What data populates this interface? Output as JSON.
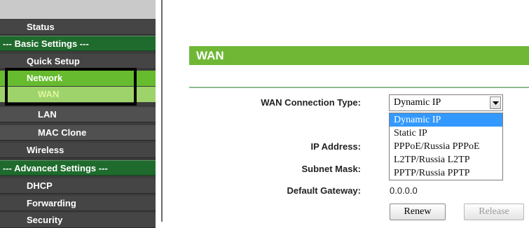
{
  "sidebar": {
    "items": [
      {
        "label": "Status"
      },
      {
        "label": "--- Basic Settings ---"
      },
      {
        "label": "Quick Setup"
      },
      {
        "label": "Network"
      },
      {
        "label": "WAN"
      },
      {
        "label": "LAN"
      },
      {
        "label": "MAC Clone"
      },
      {
        "label": "Wireless"
      },
      {
        "label": "--- Advanced Settings ---"
      },
      {
        "label": "DHCP"
      },
      {
        "label": "Forwarding"
      },
      {
        "label": "Security"
      }
    ]
  },
  "page": {
    "title": "WAN"
  },
  "form": {
    "connection_type_label": "WAN Connection Type:",
    "connection_type_value": "Dynamic IP",
    "connection_type_options": [
      "Dynamic IP",
      "Static IP",
      "PPPoE/Russia PPPoE",
      "L2TP/Russia L2TP",
      "PPTP/Russia PPTP"
    ],
    "ip_address_label": "IP Address:",
    "subnet_mask_label": "Subnet Mask:",
    "default_gateway_label": "Default Gateway:",
    "default_gateway_value": "0.0.0.0",
    "renew_label": "Renew",
    "release_label": "Release"
  },
  "colors": {
    "accent_green": "#6fb735",
    "section_green": "#1f6b2d",
    "selection_blue": "#3399ff"
  }
}
